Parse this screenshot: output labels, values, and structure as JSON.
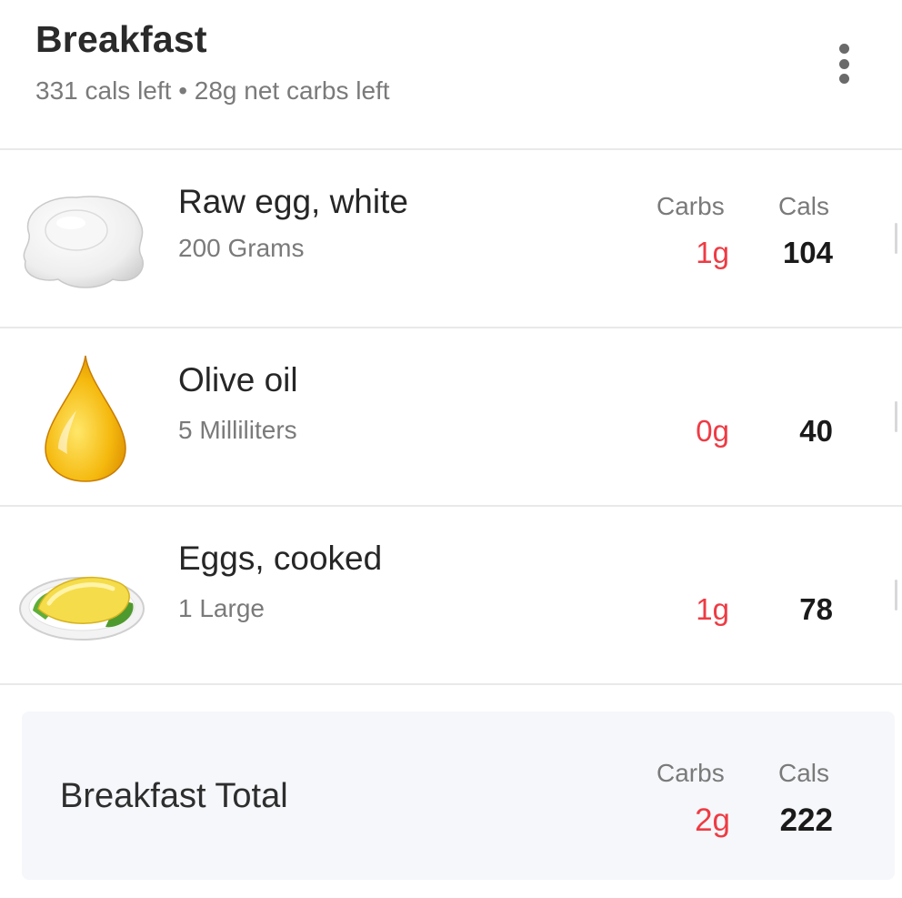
{
  "meal": {
    "title": "Breakfast",
    "subtitle": "331 cals left • 28g net carbs left",
    "menu_icon": "more-vertical-icon"
  },
  "column_headers": {
    "carbs": "Carbs",
    "cals": "Cals"
  },
  "items": [
    {
      "name": "Raw egg, white",
      "amount": "200 Grams",
      "carbs": "1g",
      "cals": "104",
      "icon": "egg-white-icon"
    },
    {
      "name": "Olive oil",
      "amount": "5 Milliliters",
      "carbs": "0g",
      "cals": "40",
      "icon": "oil-drop-icon"
    },
    {
      "name": "Eggs, cooked",
      "amount": "1 Large",
      "carbs": "1g",
      "cals": "78",
      "icon": "omelette-plate-icon"
    }
  ],
  "total": {
    "label": "Breakfast Total",
    "carbs": "2g",
    "cals": "222"
  },
  "colors": {
    "carbs": "#ee3b44",
    "total_bg": "#f5f7fa",
    "divider": "#e9e9e9"
  }
}
